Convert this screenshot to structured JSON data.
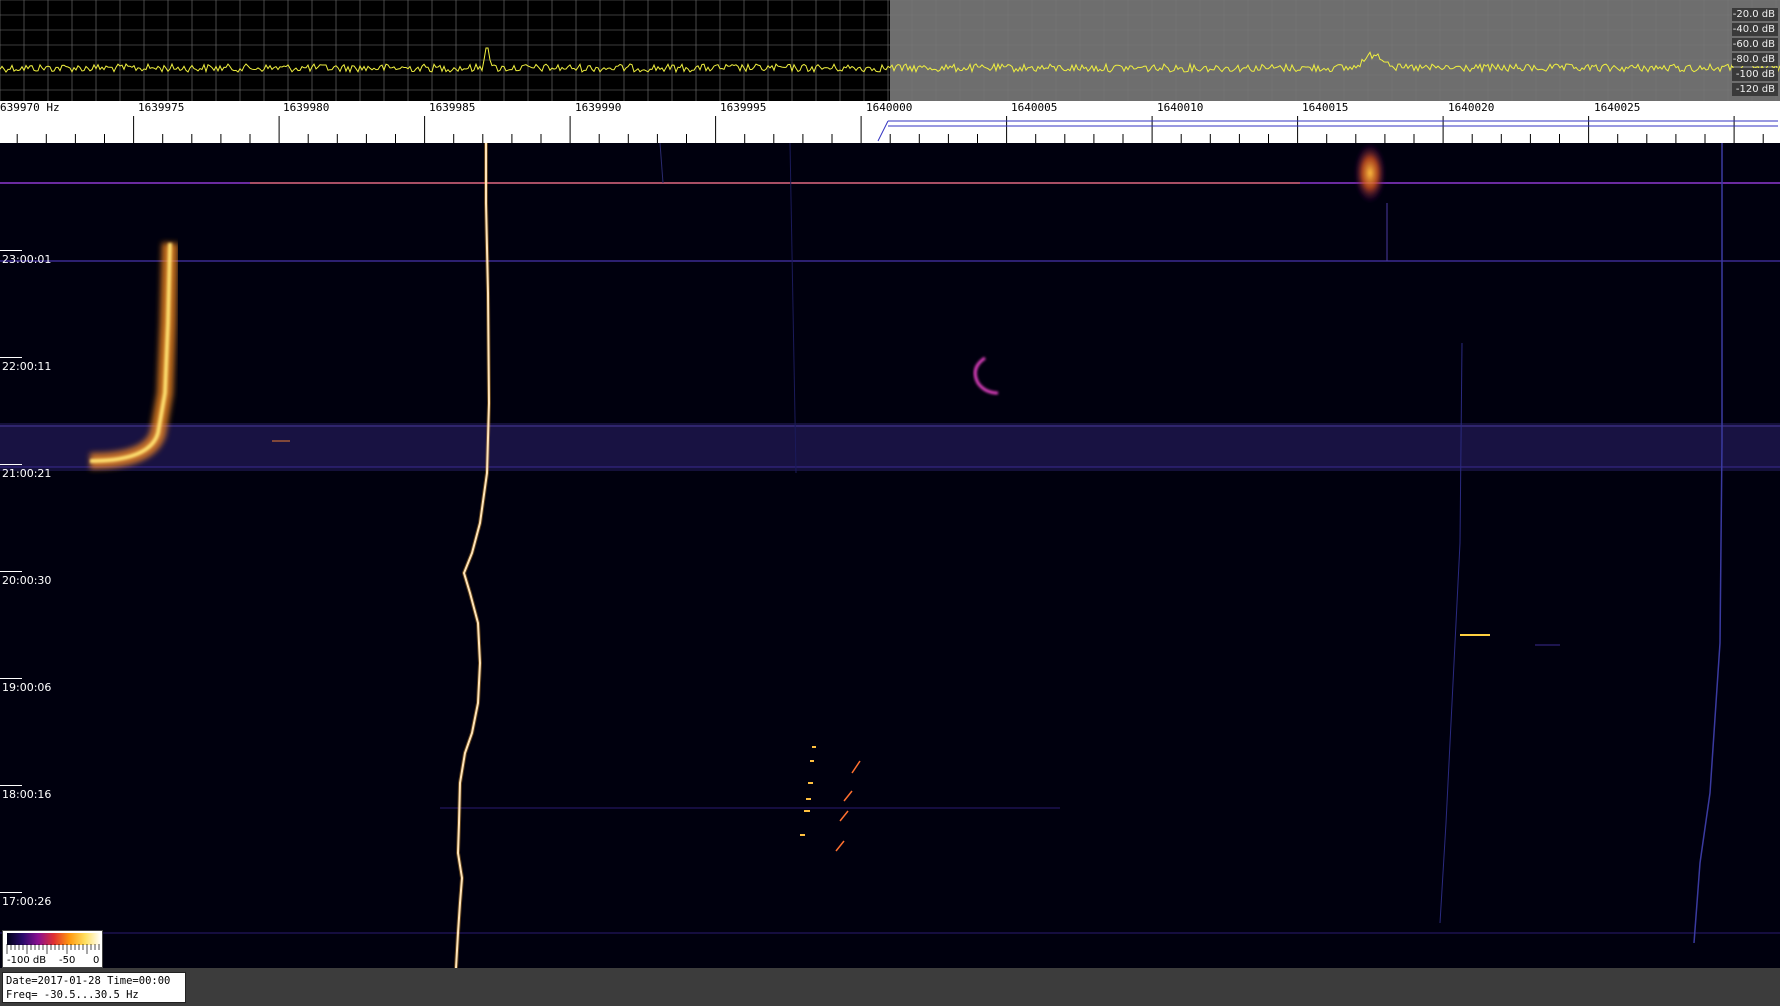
{
  "spectrum": {
    "db_levels": [
      "-20.0 dB",
      "-40.0 dB",
      "-60.0 dB",
      "-80.0 dB",
      "-100 dB",
      "-120 dB"
    ],
    "trace_color": "#f0f040",
    "left_bg": "#000000",
    "right_bg": "#707070"
  },
  "freq_scale": {
    "labels": [
      "639970 Hz",
      "1639975",
      "1639980",
      "1639985",
      "1639990",
      "1639995",
      "1640000",
      "1640005",
      "1640010",
      "1640015",
      "1640020",
      "1640025"
    ]
  },
  "time_axis": {
    "labels": [
      "23:00:01",
      "22:00:11",
      "21:00:21",
      "20:00:30",
      "19:00:06",
      "18:00:16",
      "17:00:26"
    ]
  },
  "colorbar": {
    "min_label": "-100 dB",
    "mid_label": "-50",
    "max_label": "0"
  },
  "status": {
    "line1": "Date=2017-01-28 Time=00:00",
    "line2": "Freq= -30.5...30.5 Hz"
  }
}
